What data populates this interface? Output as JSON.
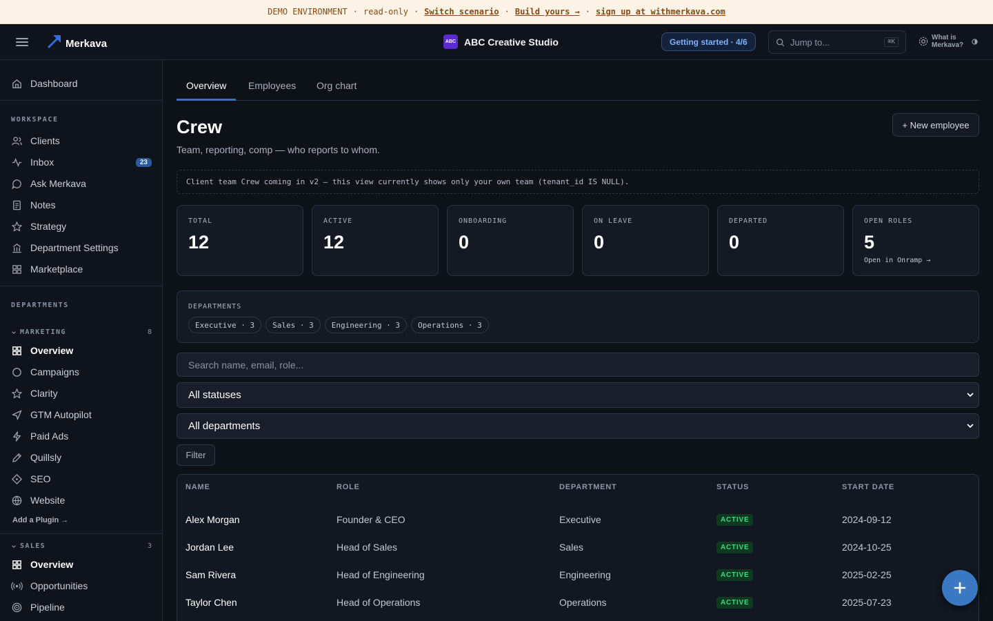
{
  "banner": {
    "env": "DEMO ENVIRONMENT",
    "mode": "read-only",
    "switch_label": "Switch scenario",
    "build_label": "Build yours →",
    "signup_label": "sign up at withmerkava.com"
  },
  "topbar": {
    "brand": "Merkava",
    "org_avatar": "ABC",
    "org_name": "ABC Creative Studio",
    "getting_started": "Getting started · 4/6",
    "jump_placeholder": "Jump to...",
    "jump_shortcut": "⌘K",
    "what_is": "What is Merkava?"
  },
  "sidebar": {
    "dashboard": "Dashboard",
    "workspace_heading": "WORKSPACE",
    "workspace_items": [
      {
        "label": "Clients",
        "icon": "users-icon"
      },
      {
        "label": "Inbox",
        "icon": "activity-icon",
        "badge": "23"
      },
      {
        "label": "Ask Merkava",
        "icon": "chat-icon"
      },
      {
        "label": "Notes",
        "icon": "notes-icon"
      },
      {
        "label": "Strategy",
        "icon": "star-icon"
      },
      {
        "label": "Department Settings",
        "icon": "building-icon"
      },
      {
        "label": "Marketplace",
        "icon": "grid-icon"
      }
    ],
    "departments_heading": "DEPARTMENTS",
    "marketing": {
      "label": "MARKETING",
      "count": "8",
      "items": [
        {
          "label": "Overview",
          "icon": "grid-icon",
          "active": true
        },
        {
          "label": "Campaigns",
          "icon": "circle-icon"
        },
        {
          "label": "Clarity",
          "icon": "star-icon"
        },
        {
          "label": "GTM Autopilot",
          "icon": "send-icon"
        },
        {
          "label": "Paid Ads",
          "icon": "bolt-icon"
        },
        {
          "label": "Quillsly",
          "icon": "pen-icon"
        },
        {
          "label": "SEO",
          "icon": "diamond-icon"
        },
        {
          "label": "Website",
          "icon": "globe-icon"
        }
      ],
      "add_plugin": "Add a Plugin →"
    },
    "sales": {
      "label": "SALES",
      "count": "3",
      "items": [
        {
          "label": "Overview",
          "icon": "grid-icon",
          "active": true
        },
        {
          "label": "Opportunities",
          "icon": "radio-icon"
        },
        {
          "label": "Pipeline",
          "icon": "target-icon"
        }
      ]
    }
  },
  "main": {
    "tabs": [
      "Overview",
      "Employees",
      "Org chart"
    ],
    "title": "Crew",
    "new_button": "+ New employee",
    "subtitle": "Team, reporting, comp — who reports to whom.",
    "notice": "Client team Crew coming in v2 — this view currently shows only your own team (tenant_id IS NULL).",
    "stats": [
      {
        "label": "TOTAL",
        "value": "12"
      },
      {
        "label": "ACTIVE",
        "value": "12"
      },
      {
        "label": "ONBOARDING",
        "value": "0"
      },
      {
        "label": "ON LEAVE",
        "value": "0"
      },
      {
        "label": "DEPARTED",
        "value": "0"
      },
      {
        "label": "OPEN ROLES",
        "value": "5",
        "link": "Open in Onramp →"
      }
    ],
    "departments_label": "DEPARTMENTS",
    "department_chips": [
      "Executive · 3",
      "Sales · 3",
      "Engineering · 3",
      "Operations · 3"
    ],
    "search_placeholder": "Search name, email, role...",
    "status_select": "All statuses",
    "department_select": "All departments",
    "filter_button": "Filter",
    "table": {
      "headers": [
        "NAME",
        "ROLE",
        "DEPARTMENT",
        "STATUS",
        "START DATE"
      ],
      "rows": [
        {
          "name": "Alex Morgan",
          "role": "Founder & CEO",
          "department": "Executive",
          "status": "ACTIVE",
          "start": "2024-09-12"
        },
        {
          "name": "Jordan Lee",
          "role": "Head of Sales",
          "department": "Sales",
          "status": "ACTIVE",
          "start": "2024-10-25"
        },
        {
          "name": "Sam Rivera",
          "role": "Head of Engineering",
          "department": "Engineering",
          "status": "ACTIVE",
          "start": "2025-02-25"
        },
        {
          "name": "Taylor Chen",
          "role": "Head of Operations",
          "department": "Operations",
          "status": "ACTIVE",
          "start": "2025-07-23"
        }
      ]
    }
  },
  "colors": {
    "accent": "#3c6fbf",
    "status_active": "#3ddc84",
    "banner_bg": "#fdf3e7"
  }
}
